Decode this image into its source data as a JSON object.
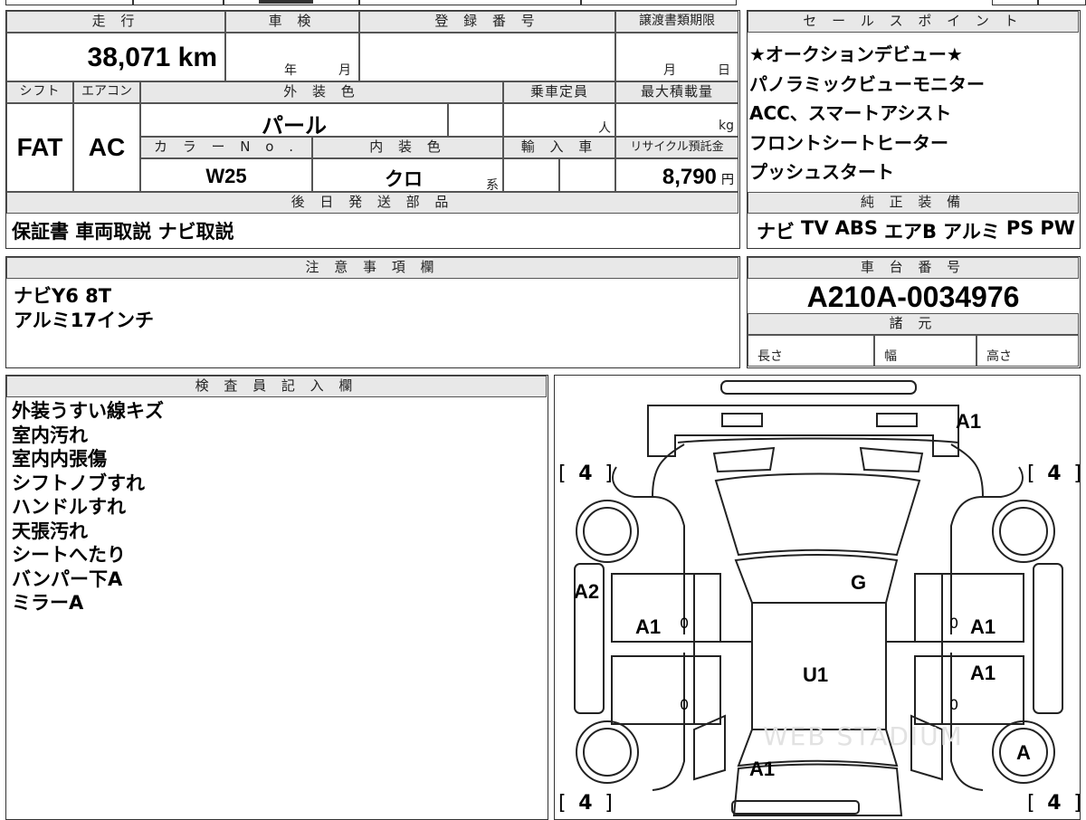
{
  "labels": {
    "mileage": "走 行",
    "shaken": "車 検",
    "reg_no": "登 録 番 号",
    "transfer_deadline": "譲渡書類期限",
    "sales_points": "セ ー ル ス ポ イ ン ト",
    "shift": "シフト",
    "aircon": "エアコン",
    "exterior_color": "外 装 色",
    "capacity": "乗車定員",
    "max_load": "最大積載量",
    "color_no": "カ ラ ー N o .",
    "interior_color": "内 装 色",
    "import": "輸 入 車",
    "recycle_fee": "リサイクル預託金",
    "later_parts": "後 日 発 送 部 品",
    "standard_equip": "純 正 装 備",
    "notes": "注 意 事 項 欄",
    "chassis": "車 台 番 号",
    "specs": "諸 元",
    "length": "長さ",
    "width": "幅",
    "height": "高さ",
    "inspector": "検 査 員 記 入 欄",
    "year_unit": "年",
    "month_unit": "月",
    "day_unit": "日",
    "person_unit": "人",
    "kg_unit": "kg",
    "yen_unit": "円",
    "kei": "系"
  },
  "vehicle": {
    "mileage": "38,071",
    "mileage_unit": "km",
    "shift": "FAT",
    "aircon": "AC",
    "exterior_color": "パール",
    "color_no": "W25",
    "interior_color": "クロ",
    "recycle_fee": "8,790",
    "chassis_no": "A210A-0034976"
  },
  "sales_points": [
    "★オークションデビュー★",
    "パノラミックビューモニター",
    "ACC、スマートアシスト",
    "フロントシートヒーター",
    "プッシュスタート"
  ],
  "later_parts": "保証書 車両取説 ナビ取説",
  "equipment": [
    "ナビ",
    "TV",
    "ABS",
    "エアB",
    "アルミ",
    "PS",
    "PW"
  ],
  "notes": [
    "ナビY6 8T",
    "アルミ17インチ"
  ],
  "inspector_notes": [
    "外装うすい線キズ",
    "室内汚れ",
    "室内内張傷",
    "シフトノブすれ",
    "ハンドルすれ",
    "天張汚れ",
    "シートへたり",
    "バンパー下A",
    "ミラーA"
  ],
  "diagram": {
    "marks": {
      "front": "A1",
      "roof": "G",
      "left_front_door": "A1",
      "right_front_door": "A1",
      "right_rear_door": "A1",
      "left_fender": "A2",
      "floor": "U1",
      "rear": "A1",
      "right_rear_tire": "A"
    },
    "tire_tread": "4",
    "zero_mark": "0",
    "bracket_open": "[",
    "bracket_close": "]"
  },
  "watermark": "WEB STADIUM"
}
